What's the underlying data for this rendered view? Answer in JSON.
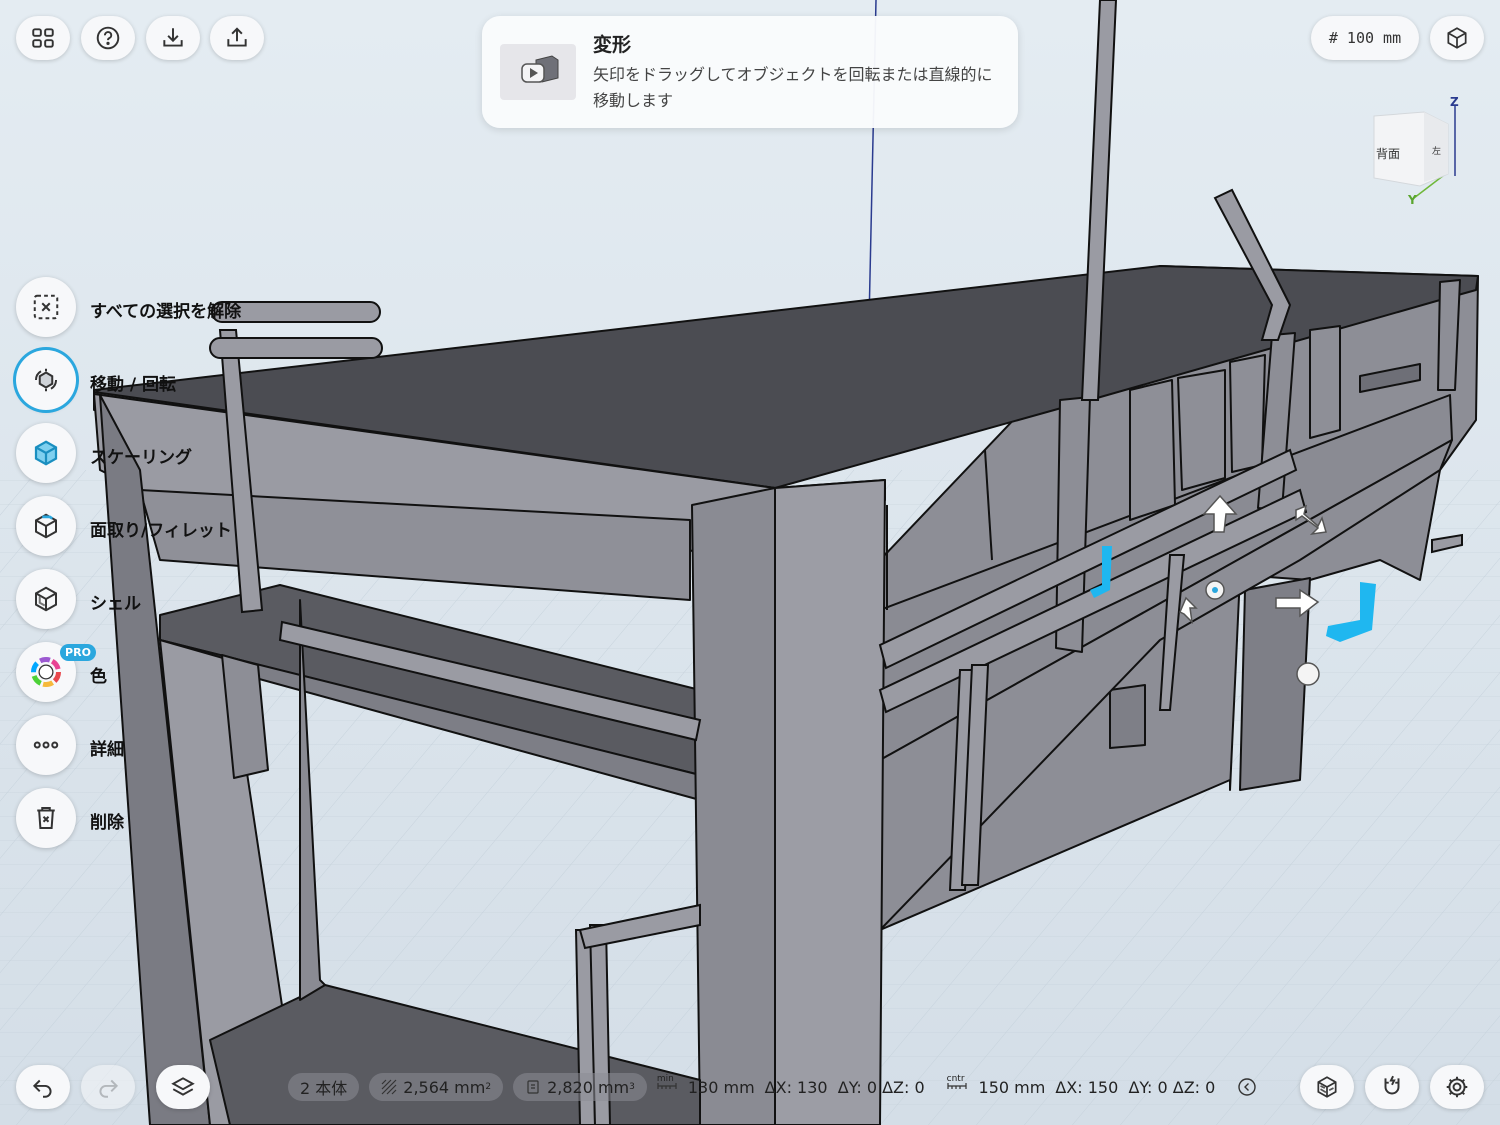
{
  "app": {
    "grid_size_label": "# 100 mm"
  },
  "tip": {
    "title": "変形",
    "text": "矢印をドラッグしてオブジェクトを回転または直線的に移動します"
  },
  "viewcube": {
    "face_back": "背面",
    "face_left": "左",
    "axis_z": "Z",
    "axis_y": "Y"
  },
  "tools": [
    {
      "label": "すべての選択を解除",
      "icon": "deselect-icon"
    },
    {
      "label": "移動 / 回転",
      "icon": "move-rotate-icon",
      "active": true
    },
    {
      "label": "スケーリング",
      "icon": "scale-cube-icon"
    },
    {
      "label": "面取り/フィレット",
      "icon": "chamfer-icon"
    },
    {
      "label": "シェル",
      "icon": "shell-icon"
    },
    {
      "label": "色",
      "icon": "color-wheel-icon",
      "badge": "PRO"
    },
    {
      "label": "詳細",
      "icon": "more-dots-icon"
    },
    {
      "label": "削除",
      "icon": "trash-icon"
    }
  ],
  "status": {
    "bodies": "2 本体",
    "area": "2,564 mm",
    "area_sup": "2",
    "volume": "2,820 mm",
    "volume_sup": "3",
    "min_label": "min",
    "min_value": "130 mm",
    "min_deltas": "ΔX: 130  ΔY: 0 ΔZ: 0",
    "cntr_label": "cntr",
    "cntr_value": "150 mm",
    "cntr_deltas": "ΔX: 150  ΔY: 0 ΔZ: 0"
  },
  "colors": {
    "accent": "#2ba7de",
    "selection": "#1fb7f0",
    "model_body": "#8d8e96",
    "model_top": "#4b4c52",
    "background": "#dde6ee"
  }
}
